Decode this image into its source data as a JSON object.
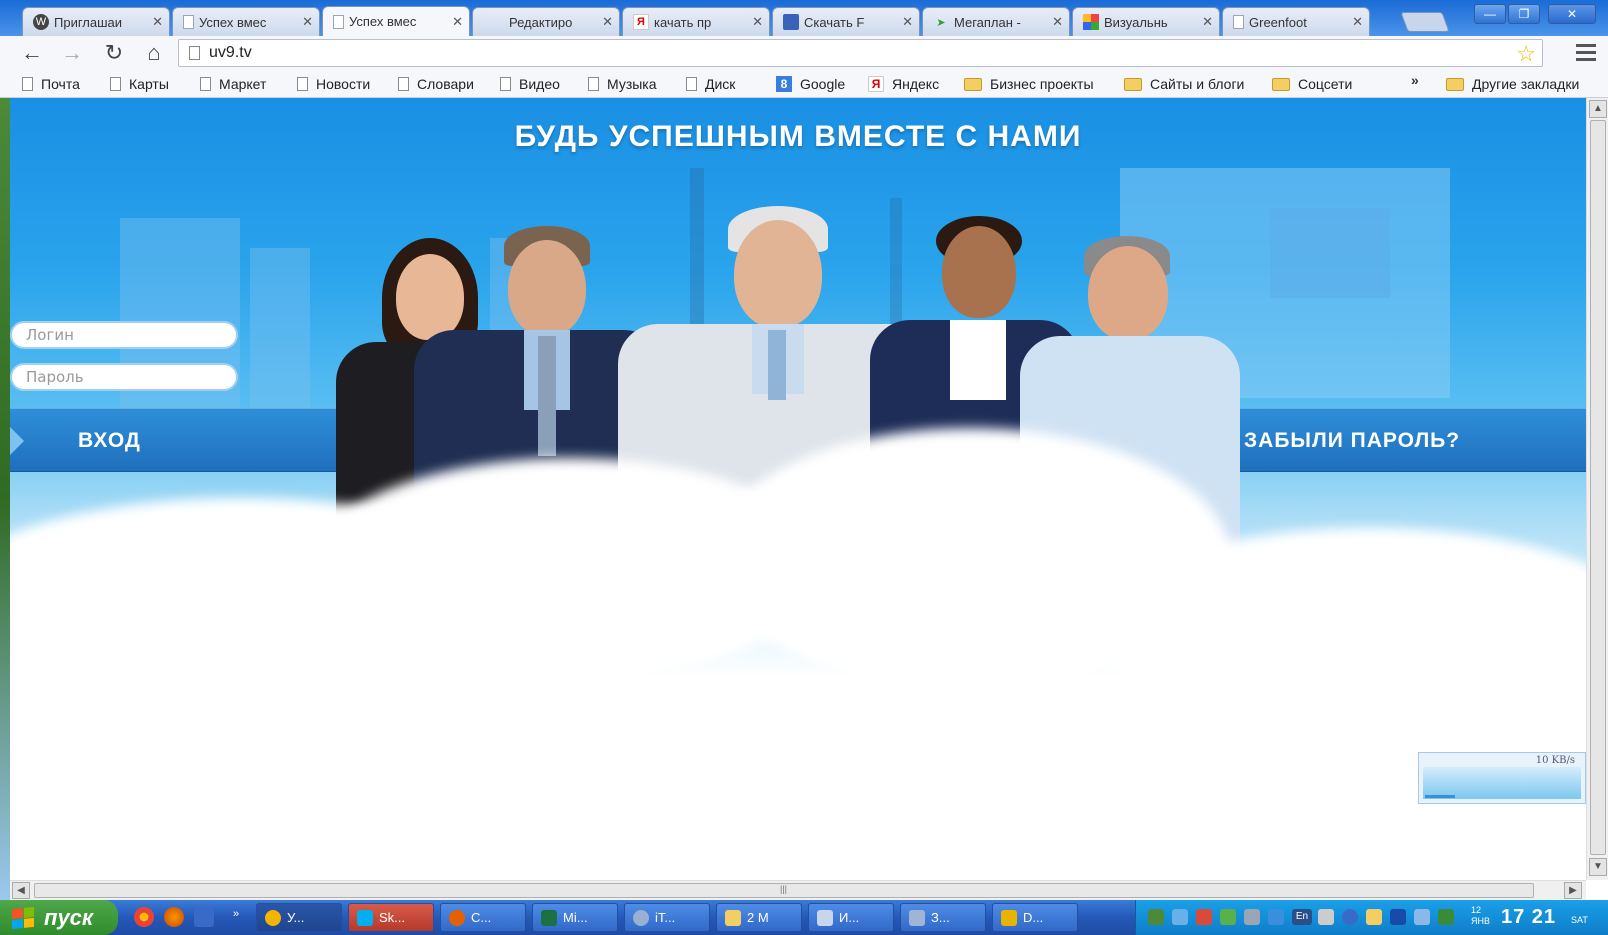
{
  "browser": {
    "tabs": [
      {
        "title": "Приглашаи",
        "icon": "wordpress-icon"
      },
      {
        "title": "Успех вмес",
        "icon": "page-icon"
      },
      {
        "title": "Успех вмес",
        "icon": "page-icon",
        "active": true
      },
      {
        "title": "Редактиро",
        "icon": "none"
      },
      {
        "title": "качать пр",
        "icon": "yandex-icon"
      },
      {
        "title": "Скачать F",
        "icon": "app-icon"
      },
      {
        "title": "Мегаплан -",
        "icon": "megaplan-icon"
      },
      {
        "title": "Визуальнь",
        "icon": "grid-icon"
      },
      {
        "title": "Greenfoot",
        "icon": "page-icon"
      }
    ],
    "url": "uv9.tv",
    "bookmarks": [
      {
        "label": "Почта",
        "icon": "page-icon"
      },
      {
        "label": "Карты",
        "icon": "page-icon"
      },
      {
        "label": "Маркет",
        "icon": "page-icon"
      },
      {
        "label": "Новости",
        "icon": "page-icon"
      },
      {
        "label": "Словари",
        "icon": "page-icon"
      },
      {
        "label": "Видео",
        "icon": "page-icon"
      },
      {
        "label": "Музыка",
        "icon": "page-icon"
      },
      {
        "label": "Диск",
        "icon": "page-icon"
      },
      {
        "label": "Google",
        "icon": "google-icon"
      },
      {
        "label": "Яндекс",
        "icon": "yandex-icon"
      },
      {
        "label": "Бизнес проекты",
        "icon": "folder-icon"
      },
      {
        "label": "Сайты и блоги",
        "icon": "folder-icon"
      },
      {
        "label": "Соцсети",
        "icon": "folder-icon"
      },
      {
        "label": "Другие закладки",
        "icon": "folder-icon"
      }
    ],
    "overflow_chevron": "»"
  },
  "page": {
    "headline": "БУДЬ УСПЕШНЫМ ВМЕСТЕ С НАМИ",
    "login_placeholder": "Логин",
    "password_placeholder": "Пароль",
    "login_button": "ВХОД",
    "forgot_password": "ЗАБЫЛИ ПАРОЛЬ?",
    "colors": {
      "sky": "#2aa4ec",
      "band": "#1f6fbd"
    }
  },
  "netmeter": {
    "rate": "10 KB/s"
  },
  "taskbar": {
    "start_label": "пуск",
    "quicklaunch_more": "»",
    "buttons": [
      {
        "label": "У...",
        "icon": "chrome-icon",
        "active": true
      },
      {
        "label": "Sk...",
        "icon": "skype-icon"
      },
      {
        "label": "С...",
        "icon": "firefox-icon"
      },
      {
        "label": "Mi...",
        "icon": "excel-icon"
      },
      {
        "label": "iT...",
        "icon": "itunes-icon"
      },
      {
        "label": "2 M",
        "icon": "folder-icon"
      },
      {
        "label": "И...",
        "icon": "app-icon"
      },
      {
        "label": "З...",
        "icon": "app-icon"
      },
      {
        "label": "D...",
        "icon": "app-icon"
      }
    ],
    "tray": {
      "lang": "En",
      "date_top": "12",
      "date_mid": "ЯНВ",
      "time": "17 21",
      "weekday": "SAT"
    }
  }
}
